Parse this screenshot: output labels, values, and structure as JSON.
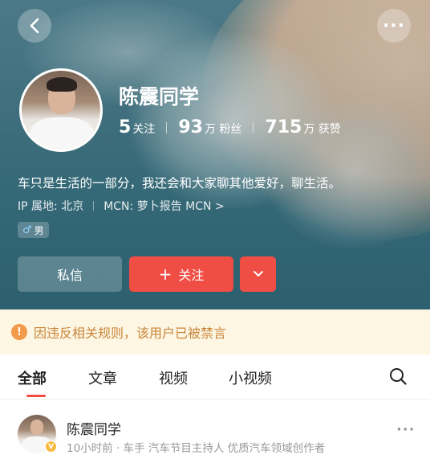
{
  "header": {
    "back_icon": "chevron-left-icon",
    "more_icon": "more-dots-icon",
    "more_label": "···"
  },
  "profile": {
    "name": "陈震同学",
    "stats": [
      {
        "value": "5",
        "label": "关注"
      },
      {
        "value": "93",
        "unit_label": "万 粉丝"
      },
      {
        "value": "715",
        "unit_label": "万 获赞"
      }
    ],
    "stats_display": {
      "following_num": "5",
      "following_label": "关注",
      "fans_num": "93",
      "fans_label": "万 粉丝",
      "likes_num": "715",
      "likes_label": "万 获赞"
    },
    "bio": "车只是生活的一部分，我还会和大家聊其他爱好，聊生活。",
    "ip_location": "IP 属地: 北京",
    "mcn": "MCN: 萝卜报告 MCN",
    "mcn_chevron": ">",
    "gender_symbol": "♂",
    "gender": "男"
  },
  "actions": {
    "message_label": "私信",
    "follow_plus": "+",
    "follow_label": "关注",
    "dropdown_icon": "chevron-down-icon"
  },
  "notice": {
    "icon": "!",
    "text": "因违反相关规则，该用户已被禁言",
    "color": "#c9853a"
  },
  "tabs": {
    "items": [
      "全部",
      "文章",
      "视频",
      "小视频"
    ],
    "active": "全部",
    "search_icon": "search-icon"
  },
  "post": {
    "author": "陈震同学",
    "badge": "V",
    "meta": "10小时前 · 车手 汽车节目主持人 优质汽车领域创作者",
    "more": "···"
  },
  "colors": {
    "accent": "#f04d44",
    "notice_bg": "#fdf6e3",
    "badge": "#f6b93b"
  }
}
